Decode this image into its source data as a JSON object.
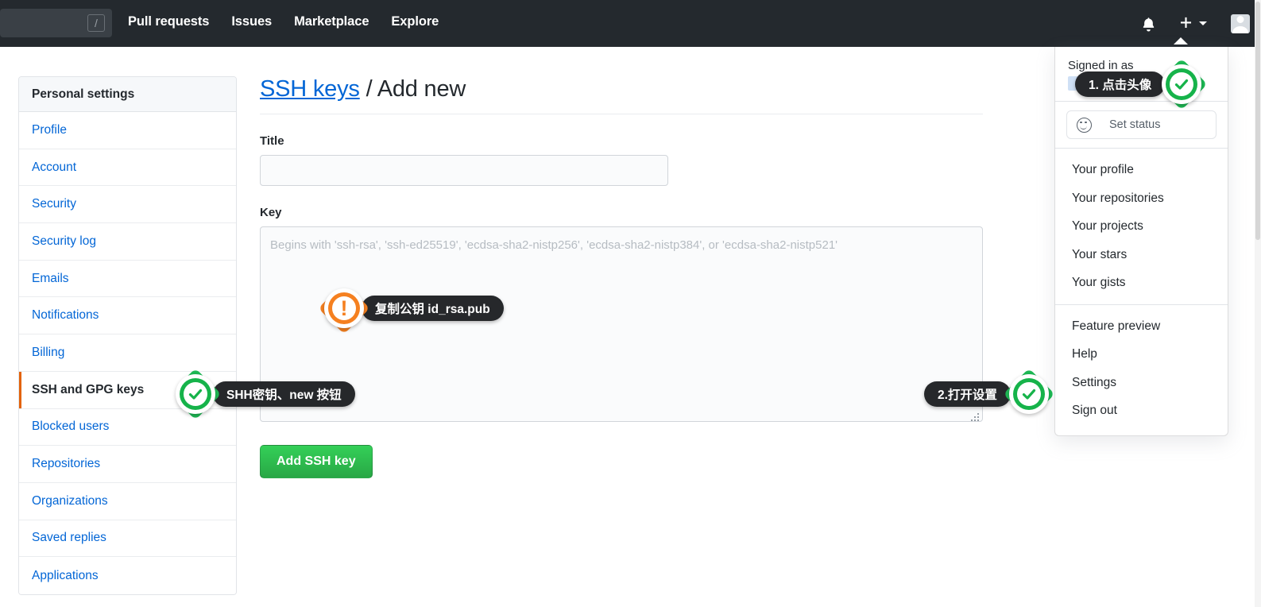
{
  "header": {
    "search": {
      "placeholder": "",
      "value": "",
      "shortcut_hint": "/"
    },
    "nav": [
      {
        "label": "Pull requests"
      },
      {
        "label": "Issues"
      },
      {
        "label": "Marketplace"
      },
      {
        "label": "Explore"
      }
    ],
    "icons": {
      "notifications": "bell-icon",
      "create_new": "plus-icon",
      "create_new_caret": "chevron-down-icon",
      "avatar": "avatar"
    }
  },
  "sidebar": {
    "title": "Personal settings",
    "items": [
      {
        "label": "Profile",
        "active": false
      },
      {
        "label": "Account",
        "active": false
      },
      {
        "label": "Security",
        "active": false
      },
      {
        "label": "Security log",
        "active": false
      },
      {
        "label": "Emails",
        "active": false
      },
      {
        "label": "Notifications",
        "active": false
      },
      {
        "label": "Billing",
        "active": false
      },
      {
        "label": "SSH and GPG keys",
        "active": true
      },
      {
        "label": "Blocked users",
        "active": false
      },
      {
        "label": "Repositories",
        "active": false
      },
      {
        "label": "Organizations",
        "active": false
      },
      {
        "label": "Saved replies",
        "active": false
      },
      {
        "label": "Applications",
        "active": false
      }
    ]
  },
  "main": {
    "breadcrumb_link": "SSH keys",
    "breadcrumb_sep": " / ",
    "breadcrumb_current": "Add new",
    "title_field": {
      "label": "Title",
      "value": "",
      "placeholder": ""
    },
    "key_field": {
      "label": "Key",
      "value": "",
      "placeholder": "Begins with 'ssh-rsa', 'ssh-ed25519', 'ecdsa-sha2-nistp256', 'ecdsa-sha2-nistp384', or 'ecdsa-sha2-nistp521'"
    },
    "submit_label": "Add SSH key"
  },
  "user_menu": {
    "signed_in_label": "Signed in as",
    "signed_in_username": "",
    "set_status": {
      "label": "Set status",
      "icon": "smiley-icon"
    },
    "groups": [
      {
        "items": [
          {
            "label": "Your profile"
          },
          {
            "label": "Your repositories"
          },
          {
            "label": "Your projects"
          },
          {
            "label": "Your stars"
          },
          {
            "label": "Your gists"
          }
        ]
      },
      {
        "items": [
          {
            "label": "Feature preview"
          },
          {
            "label": "Help"
          },
          {
            "label": "Settings"
          },
          {
            "label": "Sign out"
          }
        ]
      }
    ]
  },
  "annotations": [
    {
      "id": "anno-avatar",
      "text": "1. 点击头像",
      "style": "green",
      "icon": "check-icon"
    },
    {
      "id": "anno-settings",
      "text": "2.打开设置",
      "style": "green",
      "icon": "check-icon"
    },
    {
      "id": "anno-ssh-keys",
      "text": "SHH密钥、new 按钮",
      "style": "green",
      "icon": "check-icon"
    },
    {
      "id": "anno-copy-key",
      "text": "复制公钥 id_rsa.pub",
      "style": "orange",
      "icon": "exclamation-icon"
    }
  ],
  "colors": {
    "header_bg": "#24292e",
    "link": "#0366d6",
    "accent_green": "#28a745",
    "active_marker": "#e36209",
    "annotation_green": "#1db954",
    "annotation_orange": "#f58020"
  }
}
